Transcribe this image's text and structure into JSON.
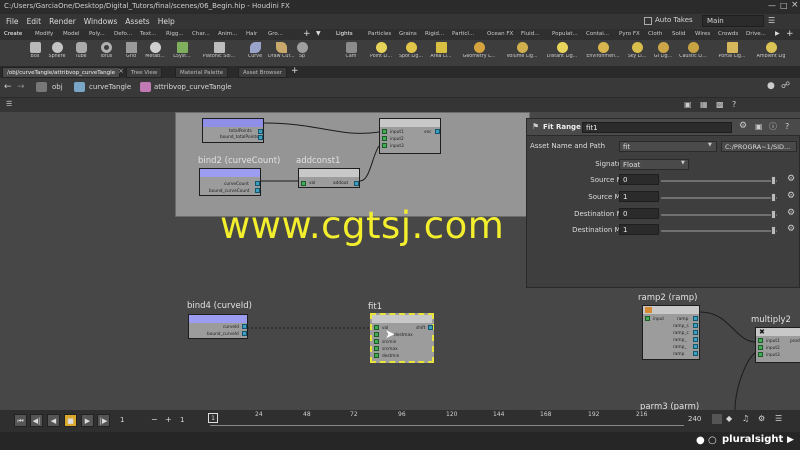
{
  "window": {
    "title": "C:/Users/GarciaOne/Desktop/Digital_Tutors/final/scenes/06_Begin.hip - Houdini FX"
  },
  "menu": {
    "items": [
      "File",
      "Edit",
      "Render",
      "Windows",
      "Assets",
      "Help"
    ],
    "auto_takes": "Auto Takes",
    "desktop": "Main"
  },
  "shelf_tabs_left": [
    "Create",
    "Modify",
    "Model",
    "Poly...",
    "Defo...",
    "Text...",
    "Rigg...",
    "Char...",
    "Anim...",
    "Hair",
    "Gro..."
  ],
  "shelf_tabs_right": [
    "Lights",
    "Particles",
    "Grains",
    "Rigid...",
    "Particl...",
    "Ocean FX",
    "Fluid...",
    "Populat...",
    "Contai...",
    "Pyro FX",
    "Cloth",
    "Solid",
    "Wires",
    "Crowds",
    "Drive..."
  ],
  "tools_left": [
    {
      "label": "Box",
      "color": "#b9b9b9"
    },
    {
      "label": "Sphere",
      "color": "#c4c4c4"
    },
    {
      "label": "Tube",
      "color": "#aaaaaa"
    },
    {
      "label": "Torus",
      "color": "#b0b0b0"
    },
    {
      "label": "Grid",
      "color": "#9a9a9a"
    },
    {
      "label": "Metab...",
      "color": "#cfcfcf"
    },
    {
      "label": "LSyst...",
      "color": "#7fae5c"
    },
    {
      "label": "Platonic Sol...",
      "color": "#bdbdbd"
    },
    {
      "label": "Curve",
      "color": "#9aa3c9"
    },
    {
      "label": "Draw Cur...",
      "color": "#c9a86b"
    },
    {
      "label": "Sp",
      "color": "#9f9f9f"
    }
  ],
  "tools_right": [
    {
      "label": "Cam",
      "color": "#8c8c8c"
    },
    {
      "label": "Point Li...",
      "color": "#e8d35a"
    },
    {
      "label": "Spot Lig...",
      "color": "#e2c64a"
    },
    {
      "label": "Area Li...",
      "color": "#d9c043"
    },
    {
      "label": "Geometry L...",
      "color": "#d6a33e"
    },
    {
      "label": "Volume Lig...",
      "color": "#d0b04c"
    },
    {
      "label": "Distant Lig...",
      "color": "#e9d55b"
    },
    {
      "label": "Environmen...",
      "color": "#d7b44e"
    },
    {
      "label": "Sky Li...",
      "color": "#d9bd4a"
    },
    {
      "label": "GI Lig...",
      "color": "#cda647"
    },
    {
      "label": "Caustic Li...",
      "color": "#c8a343"
    },
    {
      "label": "Portal Lig...",
      "color": "#d6b85c"
    },
    {
      "label": "Ambient Lig",
      "color": "#dcc355"
    }
  ],
  "pane_tabs": [
    "/obj/curveTangle/attribvop_curveTangle",
    "Tree View",
    "Material Palette",
    "Asset Browser"
  ],
  "path": {
    "obj": "obj",
    "curve": "curveTangle",
    "vop": "attribvop_curveTangle"
  },
  "params": {
    "type_label": "Fit Range",
    "node_name": "fit1",
    "asset_label": "Asset Name and Path",
    "asset_value": "fit",
    "asset_path": "C:/PROGRA~1/SID...",
    "signature_label": "Signature",
    "signature_value": "Float",
    "rows": [
      {
        "label": "Source Min",
        "value": "0"
      },
      {
        "label": "Source Max",
        "value": "1"
      },
      {
        "label": "Destination Min",
        "value": "0"
      },
      {
        "label": "Destination Max",
        "value": "1"
      }
    ]
  },
  "nodes": {
    "bind2": {
      "title": "bind2 (curveCount)",
      "ports": [
        "curveCount",
        "bound_curveCount"
      ]
    },
    "bind_top": {
      "ports": [
        "totalPoints",
        "bound_totalPoints"
      ]
    },
    "addconst1": {
      "title": "addconst1",
      "ports": [
        "val",
        "addout"
      ]
    },
    "vec_top": {
      "ports": [
        "input1",
        "input2",
        "input3",
        "vec"
      ]
    },
    "bind4": {
      "title": "bind4 (curveId)",
      "ports": [
        "curveId",
        "bound_curveId"
      ]
    },
    "fit1": {
      "title": "fit1",
      "ports": [
        "val",
        "srcmin",
        "srcmax",
        "destmin",
        "destmax",
        "shift"
      ]
    },
    "ramp2": {
      "title": "ramp2 (ramp)",
      "ports": [
        "input",
        "ramp",
        "ramp_s",
        "ramp_c",
        "ramp_",
        "ramp_",
        "ramp"
      ]
    },
    "multiply2": {
      "title": "multiply2",
      "ports": [
        "input1",
        "input2",
        "input3",
        "prod"
      ]
    },
    "parm3": {
      "title": "parm3 (parm)"
    }
  },
  "timeline": {
    "start_frame": "1",
    "step_frame": "1",
    "current": "1",
    "ticks": [
      "24",
      "48",
      "72",
      "96",
      "120",
      "144",
      "168",
      "192",
      "216"
    ],
    "end": "240"
  },
  "brand": "pluralsight",
  "watermark": "www.cgtsj.com"
}
